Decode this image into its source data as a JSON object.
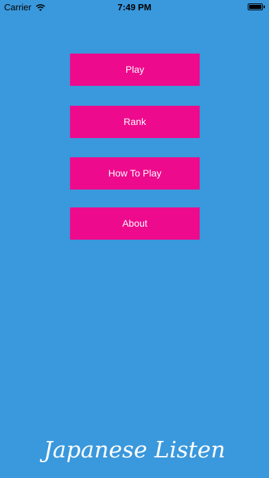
{
  "status_bar": {
    "carrier": "Carrier",
    "time": "7:49 PM",
    "wifi_icon": "wifi-icon",
    "battery_icon": "battery-icon",
    "battery_level": 1.0
  },
  "menu": {
    "play_label": "Play",
    "rank_label": "Rank",
    "how_to_play_label": "How To Play",
    "about_label": "About"
  },
  "app_title": "Japanese Listen",
  "colors": {
    "background": "#3a98dc",
    "button_background": "#ee0a8c",
    "button_text": "#ffffff",
    "title_text": "#ffffff"
  }
}
